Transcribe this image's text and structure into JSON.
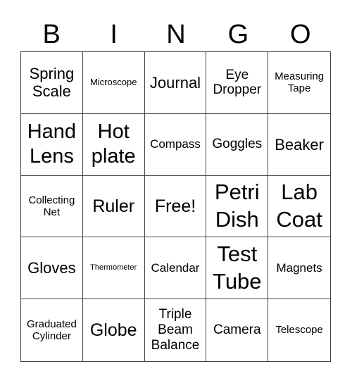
{
  "header": [
    "B",
    "I",
    "N",
    "G",
    "O"
  ],
  "cells": [
    {
      "text": "Spring Scale",
      "size": "s5"
    },
    {
      "text": "Microscope",
      "size": "s1"
    },
    {
      "text": "Journal",
      "size": "s5"
    },
    {
      "text": "Eye Dropper",
      "size": "s4"
    },
    {
      "text": "Measuring Tape",
      "size": "s2"
    },
    {
      "text": "Hand Lens",
      "size": "s7"
    },
    {
      "text": "Hot plate",
      "size": "s7"
    },
    {
      "text": "Compass",
      "size": "s3"
    },
    {
      "text": "Goggles",
      "size": "s4"
    },
    {
      "text": "Beaker",
      "size": "s5"
    },
    {
      "text": "Collecting Net",
      "size": "s2"
    },
    {
      "text": "Ruler",
      "size": "s6"
    },
    {
      "text": "Free!",
      "size": "s6"
    },
    {
      "text": "Petri Dish",
      "size": "s8"
    },
    {
      "text": "Lab Coat",
      "size": "s8"
    },
    {
      "text": "Gloves",
      "size": "s5"
    },
    {
      "text": "Thermometer",
      "size": "s0"
    },
    {
      "text": "Calendar",
      "size": "s3"
    },
    {
      "text": "Test Tube",
      "size": "s8"
    },
    {
      "text": "Magnets",
      "size": "s3"
    },
    {
      "text": "Graduated Cylinder",
      "size": "s2"
    },
    {
      "text": "Globe",
      "size": "s6"
    },
    {
      "text": "Triple Beam Balance",
      "size": "s4"
    },
    {
      "text": "Camera",
      "size": "s4"
    },
    {
      "text": "Telescope",
      "size": "s2"
    }
  ]
}
